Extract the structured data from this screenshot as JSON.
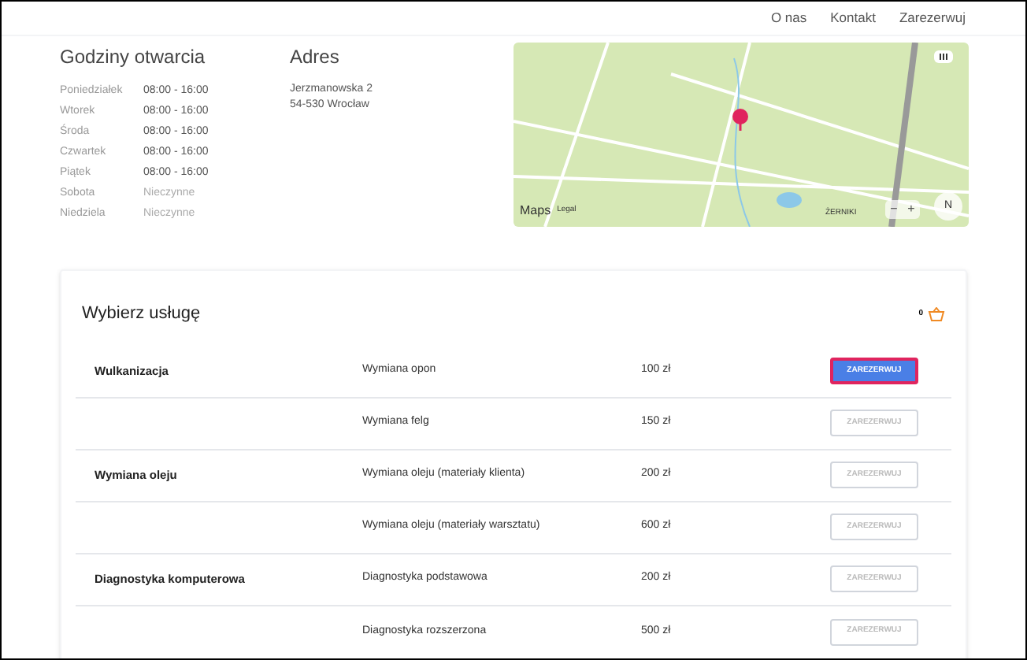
{
  "nav": [
    {
      "label": "O nas"
    },
    {
      "label": "Kontakt"
    },
    {
      "label": "Zarezerwuj"
    }
  ],
  "hours": {
    "title": "Godziny otwarcia",
    "rows": [
      {
        "day": "Poniedziałek",
        "time": "08:00 - 16:00",
        "closed": false
      },
      {
        "day": "Wtorek",
        "time": "08:00 - 16:00",
        "closed": false
      },
      {
        "day": "Środa",
        "time": "08:00 - 16:00",
        "closed": false
      },
      {
        "day": "Czwartek",
        "time": "08:00 - 16:00",
        "closed": false
      },
      {
        "day": "Piątek",
        "time": "08:00 - 16:00",
        "closed": false
      },
      {
        "day": "Sobota",
        "time": "Nieczynne",
        "closed": true
      },
      {
        "day": "Niedziela",
        "time": "Nieczynne",
        "closed": true
      }
    ]
  },
  "address": {
    "title": "Adres",
    "lines": [
      "Jerzmanowska 2",
      "54-530 Wrocław"
    ]
  },
  "map": {
    "brand": "Maps",
    "legal": "Legal",
    "place": "ŻERNIKI",
    "compass": "N",
    "zoom_out": "−",
    "zoom_in": "+"
  },
  "services": {
    "title": "Wybierz usługę",
    "cart_count": "0",
    "rows": [
      {
        "category": "Wulkanizacja",
        "name": "Wymiana opon",
        "price": "100 zł",
        "button": "ZAREZERWUJ",
        "active": true
      },
      {
        "name": "Wymiana felg",
        "price": "150 zł",
        "button": "ZAREZERWUJ",
        "active": false
      },
      {
        "category": "Wymiana oleju",
        "name": "Wymiana oleju (materiały klienta)",
        "price": "200 zł",
        "button": "ZAREZERWUJ",
        "active": false
      },
      {
        "name": "Wymiana oleju (materiały warsztatu)",
        "price": "600 zł",
        "button": "ZAREZERWUJ",
        "active": false
      },
      {
        "category": "Diagnostyka komputerowa",
        "name": "Diagnostyka podstawowa",
        "price": "200 zł",
        "button": "ZAREZERWUJ",
        "active": false
      },
      {
        "name": "Diagnostyka rozszerzona",
        "price": "500 zł",
        "button": "ZAREZERWUJ",
        "active": false
      }
    ]
  }
}
